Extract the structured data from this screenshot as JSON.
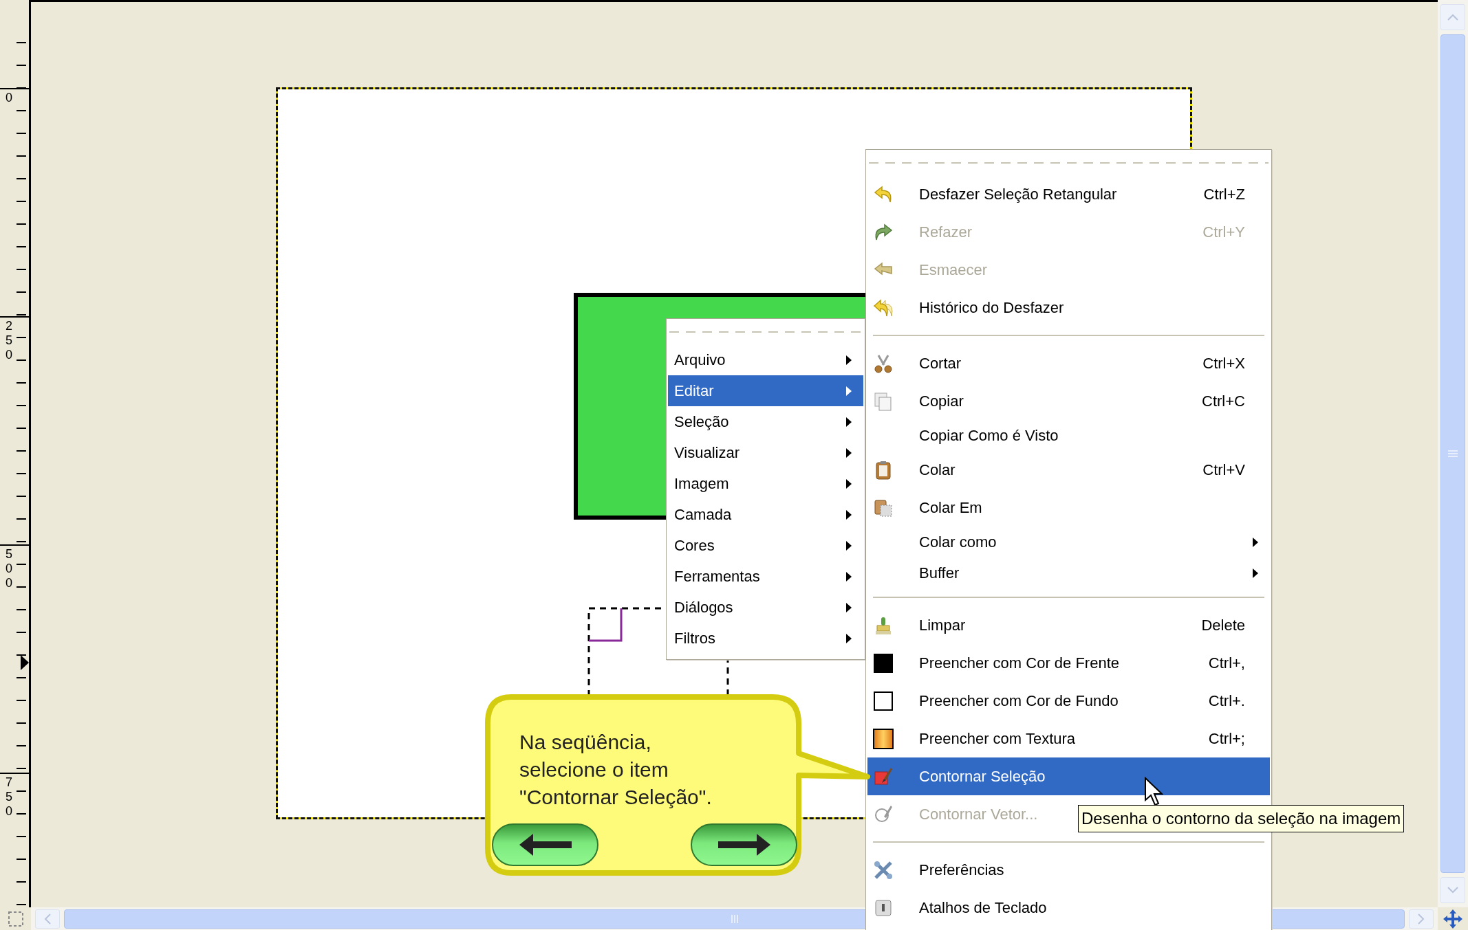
{
  "ruler": {
    "labels": [
      "0",
      "250",
      "500",
      "750"
    ]
  },
  "context_menu": {
    "items": [
      {
        "label": "Arquivo",
        "selected": false,
        "has_submenu": true
      },
      {
        "label": "Editar",
        "selected": true,
        "has_submenu": true
      },
      {
        "label": "Seleção",
        "selected": false,
        "has_submenu": true
      },
      {
        "label": "Visualizar",
        "selected": false,
        "has_submenu": true
      },
      {
        "label": "Imagem",
        "selected": false,
        "has_submenu": true
      },
      {
        "label": "Camada",
        "selected": false,
        "has_submenu": true
      },
      {
        "label": "Cores",
        "selected": false,
        "has_submenu": true
      },
      {
        "label": "Ferramentas",
        "selected": false,
        "has_submenu": true
      },
      {
        "label": "Diálogos",
        "selected": false,
        "has_submenu": true
      },
      {
        "label": "Filtros",
        "selected": false,
        "has_submenu": true
      }
    ]
  },
  "edit_menu": {
    "items": [
      {
        "kind": "item",
        "label": "Desfazer Seleção Retangular",
        "shortcut": "Ctrl+Z",
        "disabled": false,
        "selected": false,
        "has_submenu": false
      },
      {
        "kind": "item",
        "label": "Refazer",
        "shortcut": "Ctrl+Y",
        "disabled": true,
        "selected": false,
        "has_submenu": false
      },
      {
        "kind": "item",
        "label": "Esmaecer",
        "disabled": true,
        "selected": false,
        "has_submenu": false
      },
      {
        "kind": "item",
        "label": "Histórico do Desfazer",
        "disabled": false,
        "selected": false,
        "has_submenu": false
      },
      {
        "kind": "separator"
      },
      {
        "kind": "item",
        "label": "Cortar",
        "shortcut": "Ctrl+X",
        "disabled": false,
        "selected": false,
        "has_submenu": false
      },
      {
        "kind": "item",
        "label": "Copiar",
        "shortcut": "Ctrl+C",
        "disabled": false,
        "selected": false,
        "has_submenu": false
      },
      {
        "kind": "item",
        "label": "Copiar Como é Visto",
        "disabled": false,
        "selected": false,
        "has_submenu": false
      },
      {
        "kind": "item",
        "label": "Colar",
        "shortcut": "Ctrl+V",
        "disabled": false,
        "selected": false,
        "has_submenu": false
      },
      {
        "kind": "item",
        "label": "Colar Em",
        "disabled": false,
        "selected": false,
        "has_submenu": false
      },
      {
        "kind": "item",
        "label": "Colar como",
        "disabled": false,
        "selected": false,
        "has_submenu": true
      },
      {
        "kind": "item",
        "label": "Buffer",
        "disabled": false,
        "selected": false,
        "has_submenu": true
      },
      {
        "kind": "separator"
      },
      {
        "kind": "item",
        "label": "Limpar",
        "shortcut": "Delete",
        "disabled": false,
        "selected": false,
        "has_submenu": false
      },
      {
        "kind": "item",
        "label": "Preencher com Cor de Frente",
        "shortcut": "Ctrl+,",
        "disabled": false,
        "selected": false,
        "has_submenu": false
      },
      {
        "kind": "item",
        "label": "Preencher com Cor de Fundo",
        "shortcut": "Ctrl+.",
        "disabled": false,
        "selected": false,
        "has_submenu": false
      },
      {
        "kind": "item",
        "label": "Preencher com Textura",
        "shortcut": "Ctrl+;",
        "disabled": false,
        "selected": false,
        "has_submenu": false
      },
      {
        "kind": "item",
        "label": "Contornar Seleção",
        "disabled": false,
        "selected": true,
        "has_submenu": false
      },
      {
        "kind": "item",
        "label": "Contornar Vetor...",
        "disabled": true,
        "selected": false,
        "has_submenu": false
      },
      {
        "kind": "separator"
      },
      {
        "kind": "item",
        "label": "Preferências",
        "disabled": false,
        "selected": false,
        "has_submenu": false
      },
      {
        "kind": "item",
        "label": "Atalhos de Teclado",
        "disabled": false,
        "selected": false,
        "has_submenu": false
      }
    ]
  },
  "callout": {
    "text": "Na seqüência, selecione o item \"Contornar Seleção\"."
  },
  "tooltip": {
    "text": "Desenha o contorno da seleção na imagem"
  }
}
